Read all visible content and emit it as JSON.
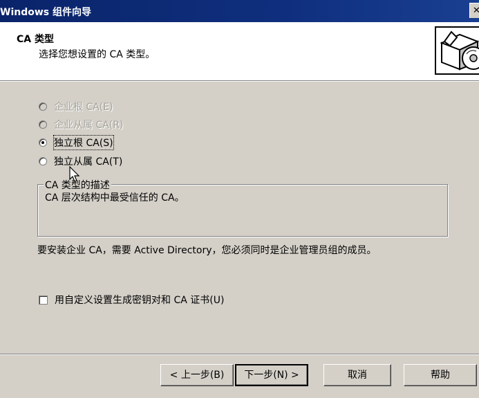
{
  "window": {
    "title": "Windows 组件向导",
    "close_glyph": "✕"
  },
  "header": {
    "title": "CA 类型",
    "subtitle": "选择您想设置的 CA 类型。",
    "icon": "wizard-box-cd-icon"
  },
  "ca_types": [
    {
      "label": "企业根 CA(E)",
      "enabled": false,
      "selected": false
    },
    {
      "label": "企业从属 CA(R)",
      "enabled": false,
      "selected": false
    },
    {
      "label": "独立根 CA(S)",
      "enabled": true,
      "selected": true
    },
    {
      "label": "独立从属 CA(T)",
      "enabled": true,
      "selected": false
    }
  ],
  "description_group": {
    "legend": "CA 类型的描述",
    "text": "CA 层次结构中最受信任的 CA。"
  },
  "note": "要安装企业 CA，需要 Active Directory，您必须同时是企业管理员组的成员。",
  "custom_keys_checkbox": {
    "label": "用自定义设置生成密钥对和 CA 证书(U)",
    "checked": false
  },
  "buttons": {
    "back": "< 上一步(B)",
    "next": "下一步(N) >",
    "cancel": "取消",
    "help": "帮助"
  }
}
